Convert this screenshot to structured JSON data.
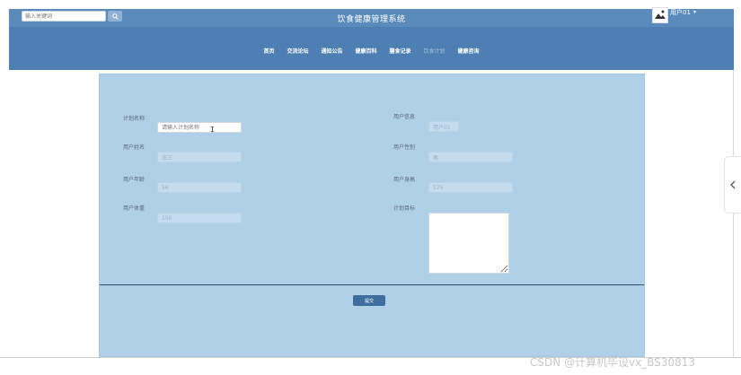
{
  "header": {
    "search_placeholder": "输入关键词",
    "title": "饮食健康管理系统",
    "user_name": "用户01",
    "user_caret": "▾"
  },
  "nav": {
    "items": [
      {
        "label": "首页",
        "active": false
      },
      {
        "label": "交流论坛",
        "active": false
      },
      {
        "label": "通知公告",
        "active": false
      },
      {
        "label": "健康百科",
        "active": false
      },
      {
        "label": "膳食记录",
        "active": false
      },
      {
        "label": "饮食计划",
        "active": true
      },
      {
        "label": "健康咨询",
        "active": false
      }
    ]
  },
  "form": {
    "plan_name_label": "计划名称",
    "plan_name_placeholder": "请输入计划名称",
    "user_info_label": "用户信息",
    "user_info_value": "用户01",
    "user_name_label": "用户姓名",
    "user_name_value": "张三",
    "user_gender_label": "用户性别",
    "user_gender_value": "男",
    "user_age_label": "用户年龄",
    "user_age_value": "56",
    "user_height_label": "用户身高",
    "user_height_value": "175",
    "user_weight_label": "用户体重",
    "user_weight_value": "150",
    "plan_goal_label": "计划目标",
    "submit_label": "提交"
  },
  "watermark": "CSDN @计算机毕设vx_BS30813",
  "colors": {
    "header_bg": "#4e7fb3",
    "panel_bg": "#b0d0e8",
    "button_bg": "#3f6e9e"
  }
}
